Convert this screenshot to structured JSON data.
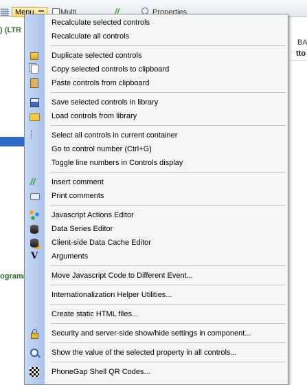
{
  "app": {
    "menu_button_label": "Menu",
    "toolbar_partial_1": "Multi",
    "toolbar_partial_2": "Properties",
    "left_partial_top": ") (LTR",
    "left_partial_bottom": "ogramm",
    "right_partial_1": "BA",
    "right_partial_2": "tto"
  },
  "menu": {
    "items": [
      {
        "label": "Recalculate selected controls",
        "icon": ""
      },
      {
        "label": "Recalculate all controls",
        "icon": ""
      },
      {
        "label": "Duplicate selected controls",
        "icon": "duplicate-icon"
      },
      {
        "label": "Copy selected controls to clipboard",
        "icon": "copy-icon"
      },
      {
        "label": "Paste controls from clipboard",
        "icon": "paste-icon"
      },
      {
        "label": "Save selected controls in library",
        "icon": "save-icon"
      },
      {
        "label": "Load controls from library",
        "icon": "folder-open-icon"
      },
      {
        "label": "Select all controls in current container",
        "icon": "tree-icon"
      },
      {
        "label": "Go to control number (Ctrl+G)",
        "icon": ""
      },
      {
        "label": "Toggle line numbers in Controls display",
        "icon": ""
      },
      {
        "label": "Insert comment",
        "icon": "comment-icon",
        "glyph": "//"
      },
      {
        "label": "Print comments",
        "icon": "printer-icon"
      },
      {
        "label": "Javascript Actions Editor",
        "icon": "javascript-actions-icon"
      },
      {
        "label": "Data Series Editor",
        "icon": "database-icon"
      },
      {
        "label": "Client-side Data Cache Editor",
        "icon": "database-cache-icon"
      },
      {
        "label": "Arguments",
        "icon": "arguments-icon",
        "glyph": "V"
      },
      {
        "label": "Move Javascript Code to Different Event...",
        "icon": ""
      },
      {
        "label": "Internationalization Helper Utilities...",
        "icon": ""
      },
      {
        "label": "Create static HTML files...",
        "icon": ""
      },
      {
        "label": "Security and server-side show/hide settings in component...",
        "icon": "lock-icon"
      },
      {
        "label": "Show the value of the selected property in all controls...",
        "icon": "find-icon"
      },
      {
        "label": "PhoneGap Shell QR Codes...",
        "icon": "qr-code-icon"
      }
    ]
  }
}
